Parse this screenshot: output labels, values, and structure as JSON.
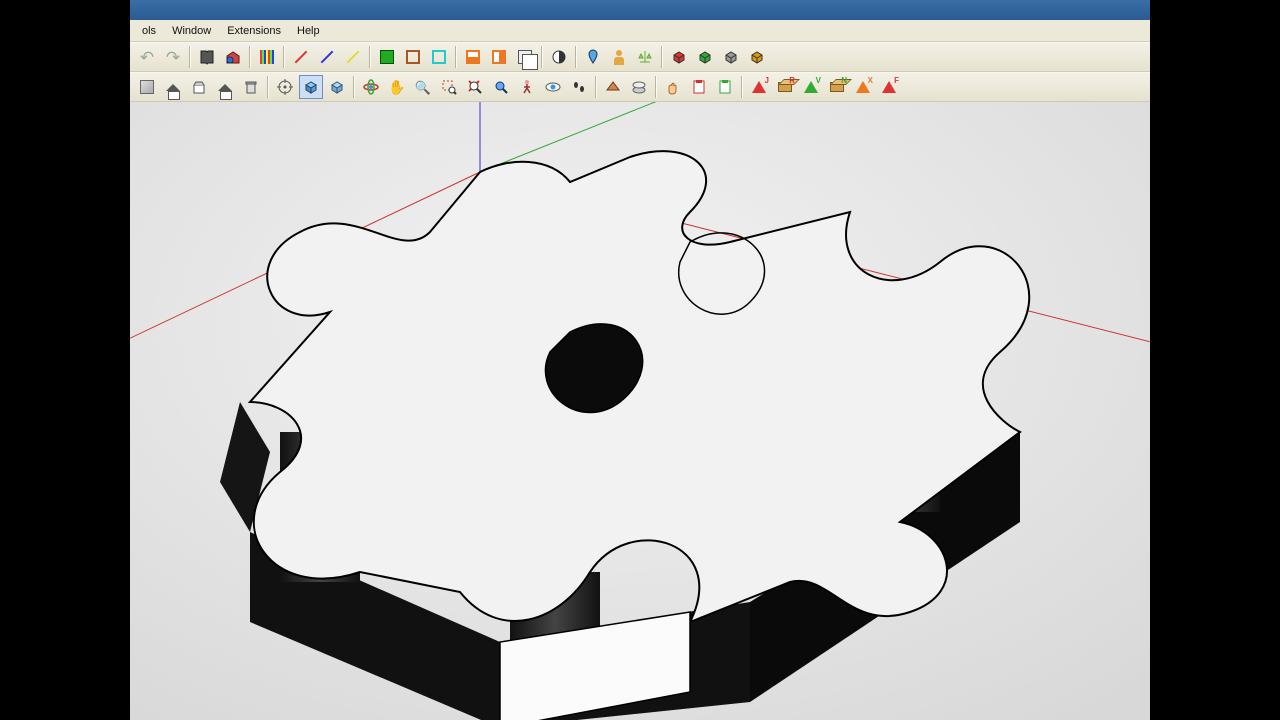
{
  "menu": {
    "items": [
      "ols",
      "Window",
      "Extensions",
      "Help"
    ]
  },
  "toolbar1": [
    {
      "name": "undo-icon",
      "sym": "↶",
      "cls": "ic-arrow-curve"
    },
    {
      "name": "redo-icon",
      "sym": "↷",
      "cls": "ic-arrow-curve"
    },
    {
      "sep": true
    },
    {
      "name": "book-icon",
      "svg": "book"
    },
    {
      "name": "warehouse-icon",
      "svg": "warehouse"
    },
    {
      "sep": true
    },
    {
      "name": "rainbow-stripes-icon",
      "cls": "ic-stripes"
    },
    {
      "sep": true
    },
    {
      "name": "red-line-icon",
      "cls": "ic-diag-red"
    },
    {
      "name": "blue-line-icon",
      "cls": "ic-diag-blue"
    },
    {
      "name": "yellow-line-icon",
      "cls": "ic-diag-yellow"
    },
    {
      "sep": true
    },
    {
      "name": "green-fill-icon",
      "cls": "ic-sq-green"
    },
    {
      "name": "brown-outline-icon",
      "cls": "ic-sq-brown"
    },
    {
      "name": "cyan-outline-icon",
      "cls": "ic-sq-cyan"
    },
    {
      "sep": true
    },
    {
      "name": "split-h-icon",
      "cls": "ic-sq-orange1"
    },
    {
      "name": "split-v-icon",
      "cls": "ic-sq-orange2"
    },
    {
      "name": "copy-icon",
      "cls": "ic-dup"
    },
    {
      "sep": true
    },
    {
      "name": "contrast-icon",
      "svg": "contrast"
    },
    {
      "sep": true
    },
    {
      "name": "pointer-geo-icon",
      "svg": "geopin"
    },
    {
      "name": "person-icon",
      "cls": "ic-person"
    },
    {
      "name": "balance-icon",
      "svg": "balance"
    },
    {
      "sep": true
    },
    {
      "name": "component-red-icon",
      "svg": "comp",
      "color": "#d33"
    },
    {
      "name": "component-green-icon",
      "svg": "comp",
      "color": "#3a3"
    },
    {
      "name": "component-grey-icon",
      "svg": "comp",
      "color": "#999"
    },
    {
      "name": "component-gold-icon",
      "svg": "comp",
      "color": "#d90"
    }
  ],
  "toolbar2": [
    {
      "name": "package-icon",
      "cls": "ic-box"
    },
    {
      "name": "home-view-icon",
      "cls": "ic-house"
    },
    {
      "name": "box-open-icon",
      "svg": "openbox"
    },
    {
      "name": "home-outline-icon",
      "cls": "ic-house"
    },
    {
      "name": "trash-icon",
      "svg": "trash"
    },
    {
      "sep": true
    },
    {
      "name": "target-icon",
      "svg": "target"
    },
    {
      "name": "iso-view-icon",
      "svg": "iso",
      "selected": true
    },
    {
      "name": "cube-view-icon",
      "svg": "cube"
    },
    {
      "sep": true
    },
    {
      "name": "orbit-icon",
      "svg": "orbit"
    },
    {
      "name": "pan-icon",
      "sym": "✋",
      "cls": "ic-hand"
    },
    {
      "name": "zoom-icon",
      "sym": "🔍",
      "cls": "ic-zoom"
    },
    {
      "name": "zoom-window-icon",
      "svg": "zoomwin"
    },
    {
      "name": "zoom-extents-icon",
      "svg": "zoomext"
    },
    {
      "name": "zoom-blue-icon",
      "svg": "zoomblue"
    },
    {
      "name": "walk-icon",
      "svg": "walk"
    },
    {
      "name": "eye-icon",
      "svg": "eye"
    },
    {
      "name": "footprints-icon",
      "svg": "feet"
    },
    {
      "sep": true
    },
    {
      "name": "section-plane-icon",
      "svg": "section"
    },
    {
      "name": "section-display-icon",
      "svg": "sectdisp"
    },
    {
      "sep": true
    },
    {
      "name": "grab-icon",
      "svg": "grab"
    },
    {
      "name": "clipboard-red-icon",
      "svg": "clipred"
    },
    {
      "name": "clipboard-green-icon",
      "svg": "clipgreen"
    },
    {
      "sep": true
    },
    {
      "name": "axes-j-icon",
      "tri": "#d33",
      "letter": "J"
    },
    {
      "name": "axes-r-icon",
      "box3d": true,
      "letter": "R",
      "lcolor": "#d33"
    },
    {
      "name": "axes-v-icon",
      "tri": "#3a3",
      "letter": "V"
    },
    {
      "name": "axes-n-icon",
      "box3d": true,
      "letter": "N",
      "lcolor": "#3a3"
    },
    {
      "name": "axes-x-icon",
      "tri": "#e72",
      "letter": "X"
    },
    {
      "name": "axes-f-icon",
      "tri": "#d33",
      "letter": "F"
    }
  ],
  "axes": {
    "red": "#cc3333",
    "green": "#33aa33",
    "blue": "#3333cc"
  }
}
